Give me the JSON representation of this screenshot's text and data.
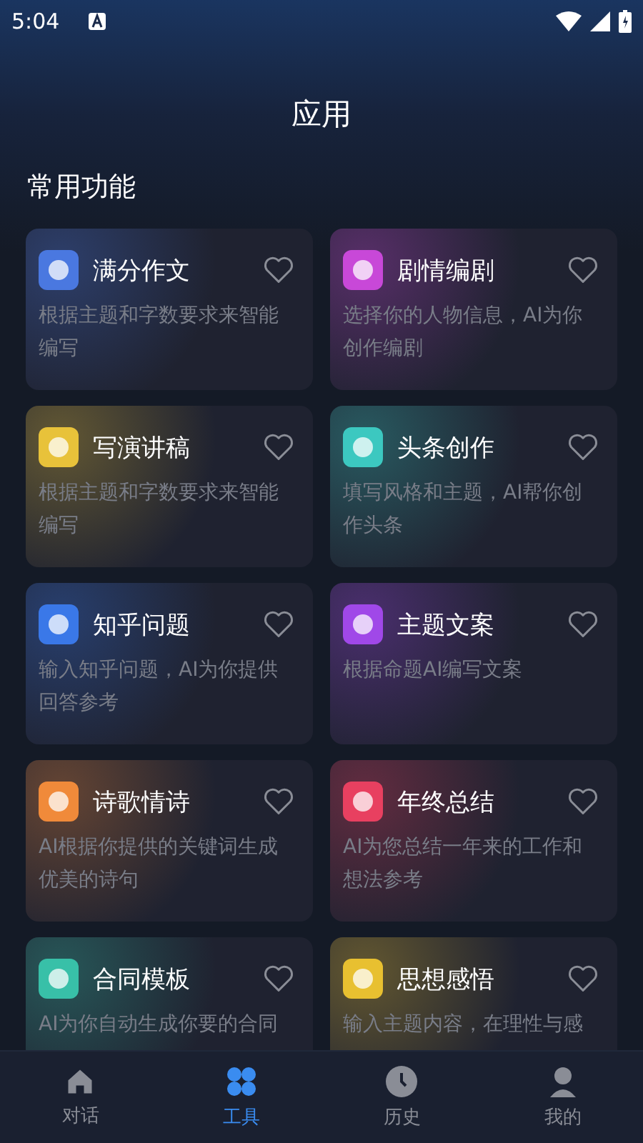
{
  "status_bar": {
    "time": "5:04"
  },
  "title": "应用",
  "section": "常用功能",
  "cards": [
    {
      "title": "满分作文",
      "desc": "根据主题和字数要求来智能编写",
      "color": "#4a78e0"
    },
    {
      "title": "剧情编剧",
      "desc": "选择你的人物信息，AI为你创作编剧",
      "color": "#c848d8"
    },
    {
      "title": "写演讲稿",
      "desc": "根据主题和字数要求来智能编写",
      "color": "#e8c23a"
    },
    {
      "title": "头条创作",
      "desc": "填写风格和主题，AI帮你创作头条",
      "color": "#3cc8c0"
    },
    {
      "title": "知乎问题",
      "desc": "输入知乎问题，AI为你提供回答参考",
      "color": "#3a78e8"
    },
    {
      "title": "主题文案",
      "desc": "根据命题AI编写文案",
      "color": "#a048e8"
    },
    {
      "title": "诗歌情诗",
      "desc": "AI根据你提供的关键词生成优美的诗句",
      "color": "#f08a3a"
    },
    {
      "title": "年终总结",
      "desc": "AI为您总结一年来的工作和想法参考",
      "color": "#e84060"
    },
    {
      "title": "合同模板",
      "desc": "AI为你自动生成你要的合同",
      "color": "#38c0a8"
    },
    {
      "title": "思想感悟",
      "desc": "输入主题内容，在理性与感",
      "color": "#e8c030"
    }
  ],
  "nav": [
    {
      "label": "对话",
      "selected": false
    },
    {
      "label": "工具",
      "selected": true
    },
    {
      "label": "历史",
      "selected": false
    },
    {
      "label": "我的",
      "selected": false
    }
  ]
}
